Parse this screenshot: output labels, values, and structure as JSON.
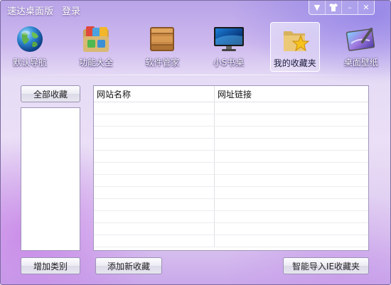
{
  "app": {
    "title": "速达桌面版",
    "login_label": "登录",
    "window_controls": [
      "▼",
      "👕",
      "–",
      "✕"
    ]
  },
  "nav": {
    "items": [
      {
        "label": "默认导航",
        "icon": "globe-icon"
      },
      {
        "label": "功能大全",
        "icon": "app-folder-icon"
      },
      {
        "label": "软件管家",
        "icon": "wooden-box-icon"
      },
      {
        "label": "小S书桌",
        "icon": "monitor-icon"
      },
      {
        "label": "我的收藏夹",
        "icon": "folder-star-icon",
        "active": true
      },
      {
        "label": "桌面壁纸",
        "icon": "wallpaper-icon"
      }
    ]
  },
  "sidebar": {
    "all_favorites_label": "全部收藏",
    "add_category_label": "增加类别"
  },
  "table": {
    "columns": [
      "网站名称",
      "网址链接"
    ],
    "rows": []
  },
  "toolbar": {
    "add_favorite_label": "添加新收藏",
    "import_ie_label": "智能导入IE收藏夹"
  },
  "colors": {
    "accent": "#b8a4e8",
    "background_bottom": "#c9a8ea"
  }
}
